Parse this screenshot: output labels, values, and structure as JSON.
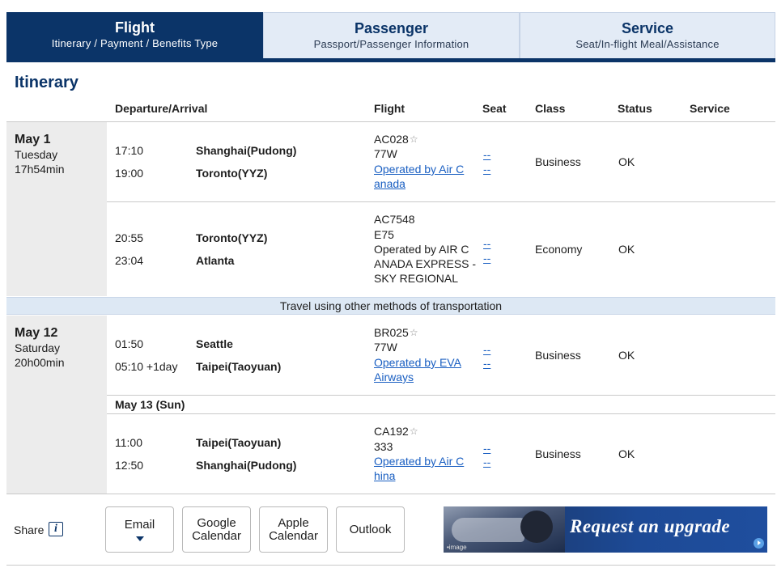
{
  "tabs": [
    {
      "title": "Flight",
      "subtitle": "Itinerary / Payment / Benefits Type"
    },
    {
      "title": "Passenger",
      "subtitle": "Passport/Passenger Information"
    },
    {
      "title": "Service",
      "subtitle": "Seat/In-flight Meal/Assistance"
    }
  ],
  "section_title": "Itinerary",
  "columns": {
    "dep_arr": "Departure/Arrival",
    "flight": "Flight",
    "seat": "Seat",
    "class": "Class",
    "status": "Status",
    "service": "Service"
  },
  "trips": [
    {
      "date": "May 1",
      "weekday": "Tuesday",
      "duration": "17h54min",
      "segments": [
        {
          "dep_time": "17:10",
          "dep_place": "Shanghai(Pudong)",
          "arr_time": "19:00",
          "arr_place": "Toronto(YYZ)",
          "flight_no": "AC028",
          "aircraft": "77W",
          "operator_lines": [
            "Operated by Air C",
            "anada"
          ],
          "seat1": "--",
          "seat2": "--",
          "class": "Business",
          "status": "OK"
        },
        {
          "dep_time": "20:55",
          "dep_place": "Toronto(YYZ)",
          "arr_time": "23:04",
          "arr_place": "Atlanta",
          "flight_no": "AC7548",
          "aircraft": "E75",
          "operator_lines": [
            "Operated by AIR C",
            "ANADA EXPRESS -",
            "SKY REGIONAL"
          ],
          "seat1": "--",
          "seat2": "--",
          "class": "Economy",
          "status": "OK"
        }
      ]
    },
    {
      "date": "May 12",
      "weekday": "Saturday",
      "duration": "20h00min",
      "segments": [
        {
          "dep_time": "01:50",
          "dep_place": "Seattle",
          "arr_time": "05:10 +1day",
          "arr_place": "Taipei(Taoyuan)",
          "flight_no": "BR025",
          "aircraft": "77W",
          "operator_lines": [
            "Operated by EVA",
            "Airways"
          ],
          "seat1": "--",
          "seat2": "--",
          "class": "Business",
          "status": "OK"
        },
        {
          "date_label": "May 13 (Sun)",
          "dep_time": "11:00",
          "dep_place": "Taipei(Taoyuan)",
          "arr_time": "12:50",
          "arr_place": "Shanghai(Pudong)",
          "flight_no": "CA192",
          "aircraft": "333",
          "operator_lines": [
            "Operated by Air C",
            "hina"
          ],
          "seat1": "--",
          "seat2": "--",
          "class": "Business",
          "status": "OK"
        }
      ]
    }
  ],
  "transport_note": "Travel using other methods of transportation",
  "share": {
    "label": "Share",
    "info_icon": "info-icon",
    "buttons": {
      "email": "Email",
      "google_1": "Google",
      "google_2": "Calendar",
      "apple_1": "Apple",
      "apple_2": "Calendar",
      "outlook": "Outlook"
    }
  },
  "upgrade": {
    "text": "Request an upgrade",
    "caption": "•image"
  },
  "colors": {
    "brand_navy": "#0b3468",
    "tab_inactive": "#e3ebf6",
    "link": "#1a5fc2",
    "date_column": "#ececec",
    "band": "#dde8f4"
  }
}
